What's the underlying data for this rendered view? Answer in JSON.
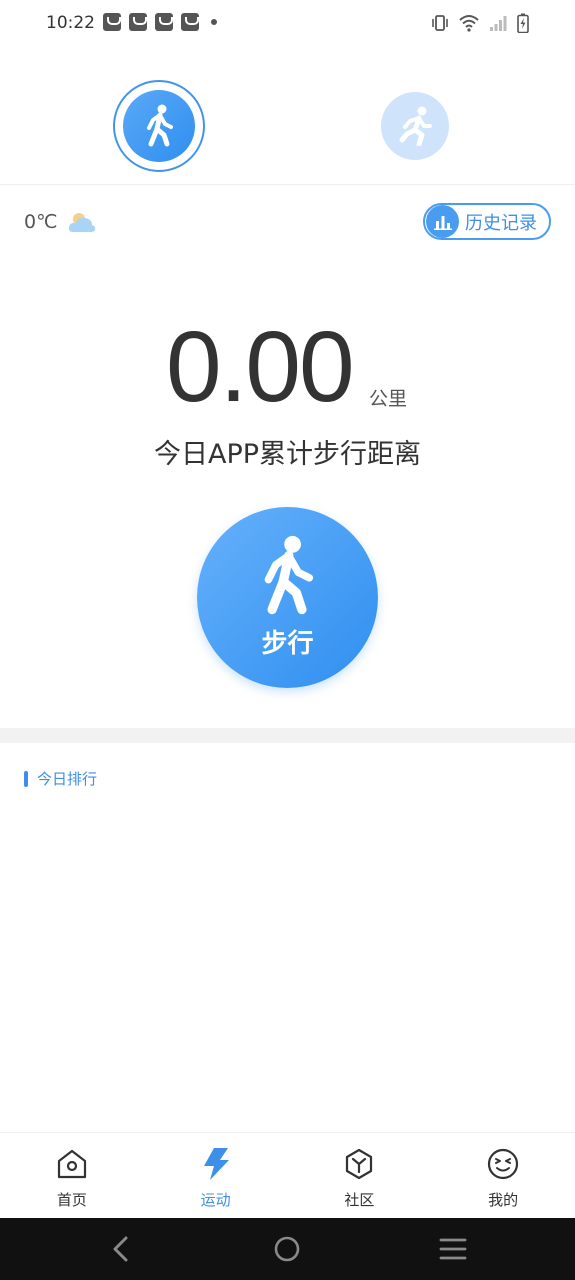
{
  "status_bar": {
    "time": "10:22",
    "notification_icons": [
      "bag-icon",
      "bag-icon",
      "bag-icon",
      "bag-icon"
    ],
    "system_icons": [
      "vibrate-icon",
      "wifi-icon",
      "signal-icon",
      "battery-charging-icon"
    ]
  },
  "mode_switch": {
    "modes": [
      {
        "icon": "walk-icon",
        "selected": true
      },
      {
        "icon": "run-icon",
        "selected": false
      }
    ]
  },
  "weather": {
    "temperature": "0℃",
    "icon": "cloud-icon"
  },
  "history": {
    "label": "历史记录",
    "icon": "bar-chart-icon"
  },
  "distance": {
    "value": "0.00",
    "unit": "公里",
    "label": "今日APP累计步行距离"
  },
  "start_button": {
    "label": "步行",
    "icon": "walk-icon"
  },
  "ranking": {
    "title": "今日排行"
  },
  "bottom_nav": {
    "items": [
      {
        "label": "首页",
        "icon": "home-icon",
        "active": false
      },
      {
        "label": "运动",
        "icon": "lightning-icon",
        "active": true
      },
      {
        "label": "社区",
        "icon": "cube-icon",
        "active": false
      },
      {
        "label": "我的",
        "icon": "face-icon",
        "active": false
      }
    ]
  },
  "colors": {
    "accent": "#3d8fe8",
    "accent_light": "#cfe4fb",
    "divider": "#f2f2f2"
  }
}
